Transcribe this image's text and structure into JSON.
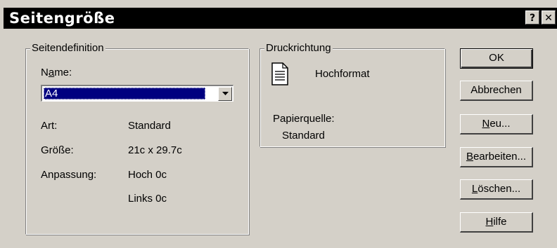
{
  "window": {
    "title": "Seitengröße",
    "help_label": "?",
    "close_label": "✕"
  },
  "seitendefinition": {
    "group_label": "Seitendefinition",
    "name_label_pre": "N",
    "name_label_u": "a",
    "name_label_post": "me:",
    "name_value": "A4",
    "art_label": "Art:",
    "art_value": "Standard",
    "groesse_label": "Größe:",
    "groesse_value": "21c x 29.7c",
    "anpassung_label": "Anpassung:",
    "anpassung_value1": "Hoch 0c",
    "anpassung_value2": "Links 0c"
  },
  "druckrichtung": {
    "group_label": "Druckrichtung",
    "orientation": "Hochformat",
    "orientation_icon": "document-icon",
    "papierquelle_label": "Papierquelle:",
    "papierquelle_value": "Standard"
  },
  "buttons": {
    "ok": "OK",
    "abbrechen": "Abbrechen",
    "neu_u": "N",
    "neu_rest": "eu...",
    "bearbeiten_u": "B",
    "bearbeiten_rest": "earbeiten...",
    "loeschen_u": "L",
    "loeschen_rest": "öschen...",
    "hilfe_u": "H",
    "hilfe_rest": "ilfe"
  },
  "colors": {
    "title_bar": "#000000",
    "selection": "#000080",
    "face": "#d4d0c8"
  }
}
